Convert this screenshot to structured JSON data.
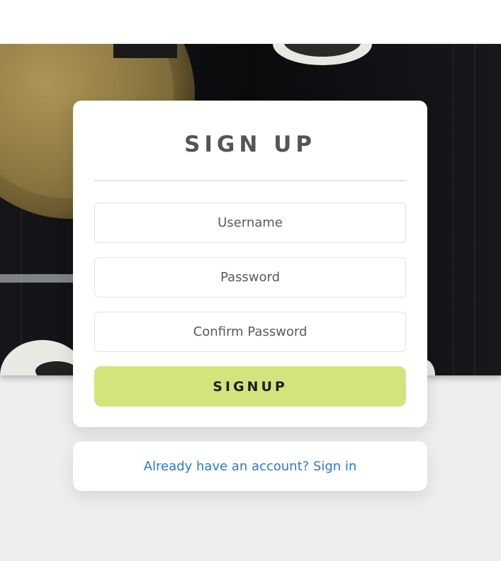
{
  "form": {
    "title": "SIGN UP",
    "username_placeholder": "Username",
    "password_placeholder": "Password",
    "confirm_placeholder": "Confirm Password",
    "submit_label": "SIGNUP"
  },
  "signin": {
    "link_text": "Already have an account? Sign in"
  },
  "colors": {
    "button": "#d4e47c",
    "link": "#2a78d8",
    "title": "#555555",
    "page_background": "#eeeeee"
  }
}
